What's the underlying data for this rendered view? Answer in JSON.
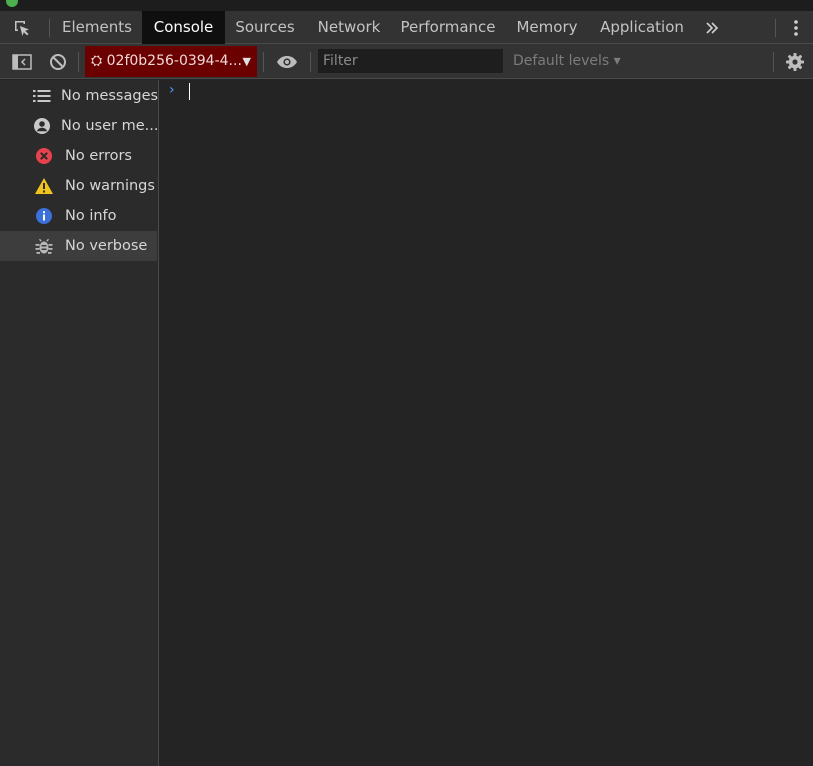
{
  "tabs": [
    {
      "label": "Elements",
      "active": false
    },
    {
      "label": "Console",
      "active": true
    },
    {
      "label": "Sources",
      "active": false
    },
    {
      "label": "Network",
      "active": false
    },
    {
      "label": "Performance",
      "active": false
    },
    {
      "label": "Memory",
      "active": false
    },
    {
      "label": "Application",
      "active": false
    }
  ],
  "tabbar": {
    "inspect_icon": "inspect-element-icon",
    "more_tabs_icon": "double-chevron-right-icon",
    "menu_icon": "vertical-dots-icon"
  },
  "toolbar": {
    "context_label": "⛭ 02f0b256-0394-4...",
    "context_bg": "#6b0000",
    "filter_placeholder": "Filter",
    "levels_label": "Default levels ▾"
  },
  "sidebar": {
    "items": [
      {
        "label": "No messages",
        "icon": "list-icon"
      },
      {
        "label": "No user me...",
        "icon": "user-icon"
      },
      {
        "label": "No errors",
        "icon": "error-icon",
        "color": "#e8424c"
      },
      {
        "label": "No warnings",
        "icon": "warning-icon",
        "color": "#f0c419"
      },
      {
        "label": "No info",
        "icon": "info-icon",
        "color": "#3b6fd9"
      },
      {
        "label": "No verbose",
        "icon": "bug-icon",
        "selected": true
      }
    ]
  },
  "console": {
    "prompt": "›"
  }
}
